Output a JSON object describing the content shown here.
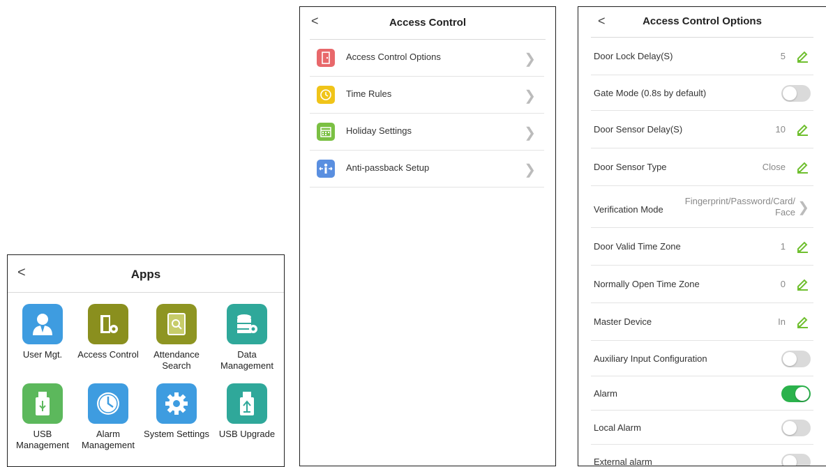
{
  "apps": {
    "back": "<",
    "title": "Apps",
    "items": [
      {
        "label": "User Mgt.",
        "icon": "user-icon",
        "color": "#3e9ce0"
      },
      {
        "label": "Access Control",
        "icon": "door-gear-icon",
        "color": "#8a8f1e"
      },
      {
        "label": "Attendance\nSearch",
        "icon": "document-search-icon",
        "color": "#8e9522"
      },
      {
        "label": "Data\nManagement",
        "icon": "database-gear-icon",
        "color": "#2fa89a"
      },
      {
        "label": "USB\nManagement",
        "icon": "usb-drive-icon",
        "color": "#5cb85c"
      },
      {
        "label": "Alarm\nManagement",
        "icon": "clock-icon",
        "color": "#3e9ce0"
      },
      {
        "label": "System Settings",
        "icon": "gear-icon",
        "color": "#3e9ce0"
      },
      {
        "label": "USB Upgrade",
        "icon": "usb-upload-icon",
        "color": "#2fa89a"
      }
    ]
  },
  "access_control": {
    "back": "<",
    "title": "Access Control",
    "items": [
      {
        "label": "Access Control Options",
        "icon": "door-icon",
        "color": "#e8686b"
      },
      {
        "label": "Time Rules",
        "icon": "clock-icon",
        "color": "#f0c419"
      },
      {
        "label": "Holiday Settings",
        "icon": "calendar-icon",
        "color": "#7bc043"
      },
      {
        "label": "Anti-passback Setup",
        "icon": "person-arrows-icon",
        "color": "#5a8fe0"
      }
    ]
  },
  "options": {
    "back": "<",
    "title": "Access Control Options",
    "rows": [
      {
        "label": "Door Lock Delay(S)",
        "kind": "edit",
        "value": "5"
      },
      {
        "label": "Gate Mode (0.8s by default)",
        "kind": "toggle",
        "on": false
      },
      {
        "label": "Door Sensor Delay(S)",
        "kind": "edit",
        "value": "10"
      },
      {
        "label": "Door Sensor Type",
        "kind": "edit",
        "value": "Close"
      },
      {
        "label": "Verification Mode",
        "kind": "nav",
        "value_line1": "Fingerprint/Password/Card/",
        "value_line2": "Face"
      },
      {
        "label": "Door Valid Time Zone",
        "kind": "edit",
        "value": "1"
      },
      {
        "label": "Normally Open Time Zone",
        "kind": "edit",
        "value": "0"
      },
      {
        "label": "Master Device",
        "kind": "edit",
        "value": "In"
      },
      {
        "label": "Auxiliary Input Configuration",
        "kind": "toggle",
        "on": false
      },
      {
        "label": "Alarm",
        "kind": "toggle",
        "on": true
      },
      {
        "label": "Local Alarm",
        "kind": "toggle",
        "on": false
      },
      {
        "label": "External alarm",
        "kind": "toggle",
        "on": false
      }
    ]
  },
  "colors": {
    "toggle_on": "#2bb24c",
    "pencil": "#6fbf2f"
  }
}
